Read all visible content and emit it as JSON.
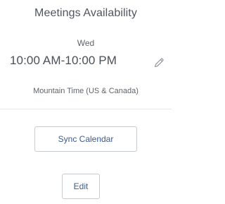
{
  "availability": {
    "title": "Meetings Availability",
    "day": "Wed",
    "time_range": "10:00 AM-10:00 PM",
    "timezone": "Mountain Time (US & Canada)",
    "edit_icon": "pencil-icon"
  },
  "actions": {
    "sync_label": "Sync Calendar",
    "edit_label": "Edit"
  }
}
